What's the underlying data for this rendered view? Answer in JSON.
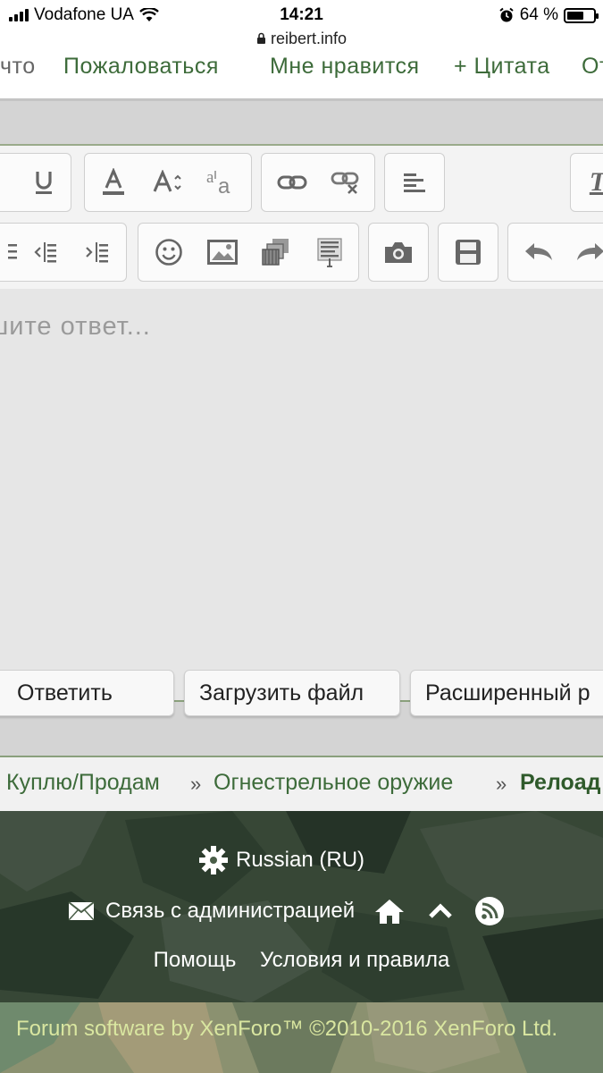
{
  "status_bar": {
    "carrier": "Vodafone UA",
    "time": "14:21",
    "url": "reibert.info",
    "battery": "64 %",
    "battery_level": 0.64
  },
  "post_actions": {
    "items": [
      "что",
      "Пожаловаться",
      "Мне нравится",
      "+ Цитата",
      "От"
    ]
  },
  "editor": {
    "placeholder": "шите ответ..."
  },
  "buttons": {
    "reply": "Ответить",
    "upload": "Загрузить файл",
    "advanced": "Расширенный р"
  },
  "breadcrumb": {
    "items": [
      "Куплю/Продам",
      "Огнестрельное оружие",
      "Релоад"
    ],
    "separator": "»"
  },
  "footer": {
    "language": "Russian (RU)",
    "contact": "Связь с администрацией",
    "help": "Помощь",
    "terms": "Условия и правила",
    "copyright": "Forum software by XenForo™ ©2010-2016 XenForo Ltd."
  },
  "colors": {
    "link_green": "#3d6b3a",
    "footer_camo": "#3f5440",
    "copyright_text": "#d9e6a0"
  }
}
